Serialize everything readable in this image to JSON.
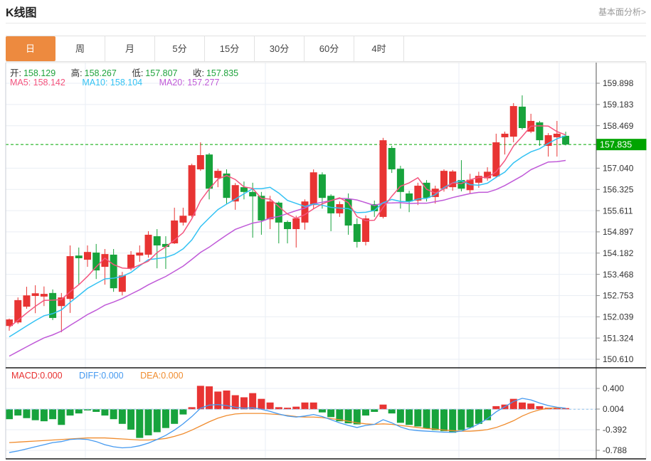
{
  "header": {
    "title": "K线图",
    "link": "基本面分析>"
  },
  "tabs": {
    "items": [
      "日",
      "周",
      "月",
      "5分",
      "15分",
      "30分",
      "60分",
      "4时"
    ],
    "active": "日",
    "active_bg": "#ed8a3f"
  },
  "legend": {
    "ohlc": {
      "items": [
        {
          "label": "开:",
          "value": "158.129"
        },
        {
          "label": "高:",
          "value": "158.267"
        },
        {
          "label": "低:",
          "value": "157.807"
        },
        {
          "label": "收:",
          "value": "157.835"
        }
      ],
      "value_color": "#1fa33c",
      "label_color": "#333333"
    },
    "ma": {
      "items": [
        {
          "text": "MA5: 158.142",
          "color": "#f4547e"
        },
        {
          "text": "MA10: 158.104",
          "color": "#33c2f3"
        },
        {
          "text": "MA20: 157.277",
          "color": "#c05ad8"
        }
      ]
    },
    "macd": {
      "items": [
        {
          "text": "MACD:0.000",
          "color": "#e83030"
        },
        {
          "text": "DIFF:0.000",
          "color": "#4499f0"
        },
        {
          "text": "DEA:0.000",
          "color": "#f08c2e"
        }
      ]
    }
  },
  "chart_data": {
    "type": "candlestick+macd",
    "main": {
      "y_ticks": [
        "159.898",
        "159.183",
        "158.469",
        "157.040",
        "156.325",
        "155.611",
        "154.897",
        "154.182",
        "153.468",
        "152.753",
        "152.039",
        "151.324",
        "150.610"
      ],
      "current_price": "157.835",
      "ma_periods": [
        5,
        10,
        20
      ],
      "candles": [
        [
          151.73,
          151.98,
          151.57,
          151.95
        ],
        [
          151.85,
          152.69,
          151.8,
          152.6
        ],
        [
          152.38,
          153.05,
          152.31,
          152.76
        ],
        [
          152.74,
          153.1,
          152.16,
          152.83
        ],
        [
          152.72,
          153.06,
          152.4,
          152.81
        ],
        [
          152.84,
          152.96,
          151.93,
          152.0
        ],
        [
          152.4,
          152.84,
          151.52,
          152.69
        ],
        [
          152.64,
          154.44,
          152.17,
          154.08
        ],
        [
          154.1,
          154.37,
          153.12,
          154.01
        ],
        [
          153.96,
          154.44,
          153.72,
          154.22
        ],
        [
          154.2,
          154.49,
          153.31,
          153.6
        ],
        [
          153.72,
          154.32,
          153.12,
          154.15
        ],
        [
          154.13,
          154.32,
          152.88,
          153.0
        ],
        [
          152.88,
          153.55,
          152.76,
          153.43
        ],
        [
          153.67,
          154.25,
          153.6,
          154.13
        ],
        [
          154.1,
          154.44,
          153.89,
          154.2
        ],
        [
          154.13,
          154.92,
          154.03,
          154.8
        ],
        [
          154.75,
          154.99,
          153.67,
          154.44
        ],
        [
          154.49,
          154.75,
          153.65,
          154.39
        ],
        [
          154.51,
          155.71,
          154.49,
          155.28
        ],
        [
          155.21,
          155.71,
          155.11,
          155.44
        ],
        [
          155.44,
          157.19,
          155.39,
          157.14
        ],
        [
          157.0,
          157.91,
          156.95,
          157.48
        ],
        [
          157.5,
          157.55,
          155.99,
          156.35
        ],
        [
          156.71,
          157.02,
          156.4,
          156.95
        ],
        [
          156.86,
          157.0,
          155.83,
          156.04
        ],
        [
          155.92,
          156.54,
          155.64,
          156.47
        ],
        [
          156.4,
          156.59,
          155.99,
          156.24
        ],
        [
          156.24,
          156.55,
          154.7,
          156.09
        ],
        [
          156.11,
          156.24,
          154.8,
          155.28
        ],
        [
          155.32,
          156.11,
          154.99,
          155.92
        ],
        [
          155.88,
          155.92,
          154.51,
          155.21
        ],
        [
          155.23,
          155.28,
          154.51,
          154.99
        ],
        [
          154.99,
          155.44,
          154.37,
          155.35
        ],
        [
          155.21,
          155.99,
          154.97,
          155.92
        ],
        [
          155.8,
          157.0,
          155.68,
          156.9
        ],
        [
          156.83,
          156.9,
          155.68,
          156.04
        ],
        [
          156.11,
          156.16,
          154.92,
          155.52
        ],
        [
          155.52,
          155.92,
          155.4,
          155.83
        ],
        [
          156.0,
          156.19,
          154.8,
          155.11
        ],
        [
          155.16,
          155.35,
          154.37,
          154.56
        ],
        [
          154.56,
          155.45,
          154.44,
          155.35
        ],
        [
          155.83,
          155.95,
          155.4,
          155.59
        ],
        [
          155.4,
          158.06,
          155.35,
          157.98
        ],
        [
          157.72,
          157.79,
          156.88,
          157.0
        ],
        [
          157.02,
          157.12,
          155.68,
          156.24
        ],
        [
          156.19,
          156.28,
          155.56,
          155.92
        ],
        [
          155.95,
          156.55,
          155.8,
          156.45
        ],
        [
          156.55,
          156.64,
          155.92,
          156.04
        ],
        [
          156.07,
          156.45,
          155.85,
          156.35
        ],
        [
          156.35,
          157.0,
          156.25,
          156.95
        ],
        [
          156.4,
          156.98,
          156.28,
          156.93
        ],
        [
          156.64,
          157.31,
          156.26,
          156.35
        ],
        [
          156.3,
          156.85,
          156.2,
          156.65
        ],
        [
          156.55,
          156.92,
          156.38,
          156.78
        ],
        [
          156.7,
          157.07,
          156.62,
          156.92
        ],
        [
          156.76,
          158.2,
          156.71,
          157.91
        ],
        [
          158.08,
          158.27,
          157.5,
          158.2
        ],
        [
          158.1,
          159.23,
          157.91,
          159.13
        ],
        [
          159.11,
          159.49,
          158.34,
          158.39
        ],
        [
          158.27,
          158.87,
          158.22,
          158.63
        ],
        [
          158.58,
          158.63,
          157.79,
          157.98
        ],
        [
          157.79,
          158.22,
          157.43,
          158.15
        ],
        [
          158.08,
          158.63,
          157.43,
          158.2
        ],
        [
          158.129,
          158.267,
          157.807,
          157.835
        ]
      ]
    },
    "macd": {
      "y_ticks": [
        "0.400",
        "0.004",
        "-0.392",
        "-0.788"
      ],
      "hist": [
        -0.19,
        -0.12,
        -0.17,
        -0.21,
        -0.23,
        -0.19,
        -0.3,
        -0.12,
        -0.08,
        -0.02,
        -0.05,
        -0.12,
        -0.19,
        -0.28,
        -0.39,
        -0.55,
        -0.5,
        -0.44,
        -0.36,
        -0.28,
        -0.1,
        0.04,
        0.45,
        0.44,
        0.34,
        0.36,
        0.27,
        0.23,
        0.31,
        0.2,
        0.13,
        0.04,
        0.03,
        0.05,
        0.13,
        0.13,
        -0.06,
        -0.15,
        -0.23,
        -0.27,
        -0.29,
        -0.12,
        -0.05,
        0.09,
        -0.08,
        -0.26,
        -0.3,
        -0.33,
        -0.37,
        -0.4,
        -0.42,
        -0.45,
        -0.4,
        -0.35,
        -0.28,
        -0.21,
        0.06,
        0.09,
        0.2,
        0.13,
        0.11,
        0.06,
        0.03,
        0.02,
        0.02
      ],
      "diff": [
        -0.83,
        -0.8,
        -0.76,
        -0.72,
        -0.68,
        -0.64,
        -0.62,
        -0.58,
        -0.57,
        -0.58,
        -0.62,
        -0.68,
        -0.72,
        -0.74,
        -0.73,
        -0.7,
        -0.65,
        -0.58,
        -0.5,
        -0.4,
        -0.28,
        -0.14,
        0.02,
        0.08,
        0.09,
        0.07,
        0.04,
        0.02,
        0.03,
        0.0,
        -0.04,
        -0.09,
        -0.13,
        -0.15,
        -0.13,
        -0.1,
        -0.14,
        -0.2,
        -0.26,
        -0.31,
        -0.35,
        -0.31,
        -0.29,
        -0.2,
        -0.26,
        -0.34,
        -0.39,
        -0.41,
        -0.42,
        -0.43,
        -0.44,
        -0.44,
        -0.42,
        -0.36,
        -0.28,
        -0.18,
        -0.05,
        0.05,
        0.15,
        0.21,
        0.18,
        0.12,
        0.07,
        0.04,
        0.02
      ],
      "dea": [
        -0.64,
        -0.63,
        -0.62,
        -0.61,
        -0.6,
        -0.59,
        -0.58,
        -0.57,
        -0.56,
        -0.55,
        -0.55,
        -0.55,
        -0.56,
        -0.57,
        -0.58,
        -0.59,
        -0.59,
        -0.58,
        -0.56,
        -0.52,
        -0.47,
        -0.4,
        -0.32,
        -0.24,
        -0.17,
        -0.12,
        -0.09,
        -0.08,
        -0.08,
        -0.08,
        -0.09,
        -0.1,
        -0.12,
        -0.14,
        -0.15,
        -0.15,
        -0.16,
        -0.18,
        -0.2,
        -0.23,
        -0.26,
        -0.28,
        -0.29,
        -0.28,
        -0.29,
        -0.31,
        -0.33,
        -0.35,
        -0.37,
        -0.38,
        -0.4,
        -0.41,
        -0.42,
        -0.42,
        -0.41,
        -0.39,
        -0.35,
        -0.29,
        -0.22,
        -0.13,
        -0.06,
        -0.01,
        0.02,
        0.03,
        0.02
      ]
    },
    "colors": {
      "up": "#e83433",
      "down": "#17a33c",
      "ma5": "#f4547e",
      "ma10": "#33c2f3",
      "ma20": "#c05ad8",
      "diff": "#4499f0",
      "dea": "#f08c2e",
      "price_line": "#00a800",
      "badge_bg": "#00a400",
      "badge_text": "#ffffff",
      "grid": "#e9eef4",
      "axis_text": "#333333",
      "tick": "#888888",
      "border_light": "#e4e4e4",
      "border_left": "#c9ced4",
      "dark_line": "#1a1a1a",
      "axis_line": "#555555",
      "macd_zero": "#8fc1ea"
    }
  }
}
